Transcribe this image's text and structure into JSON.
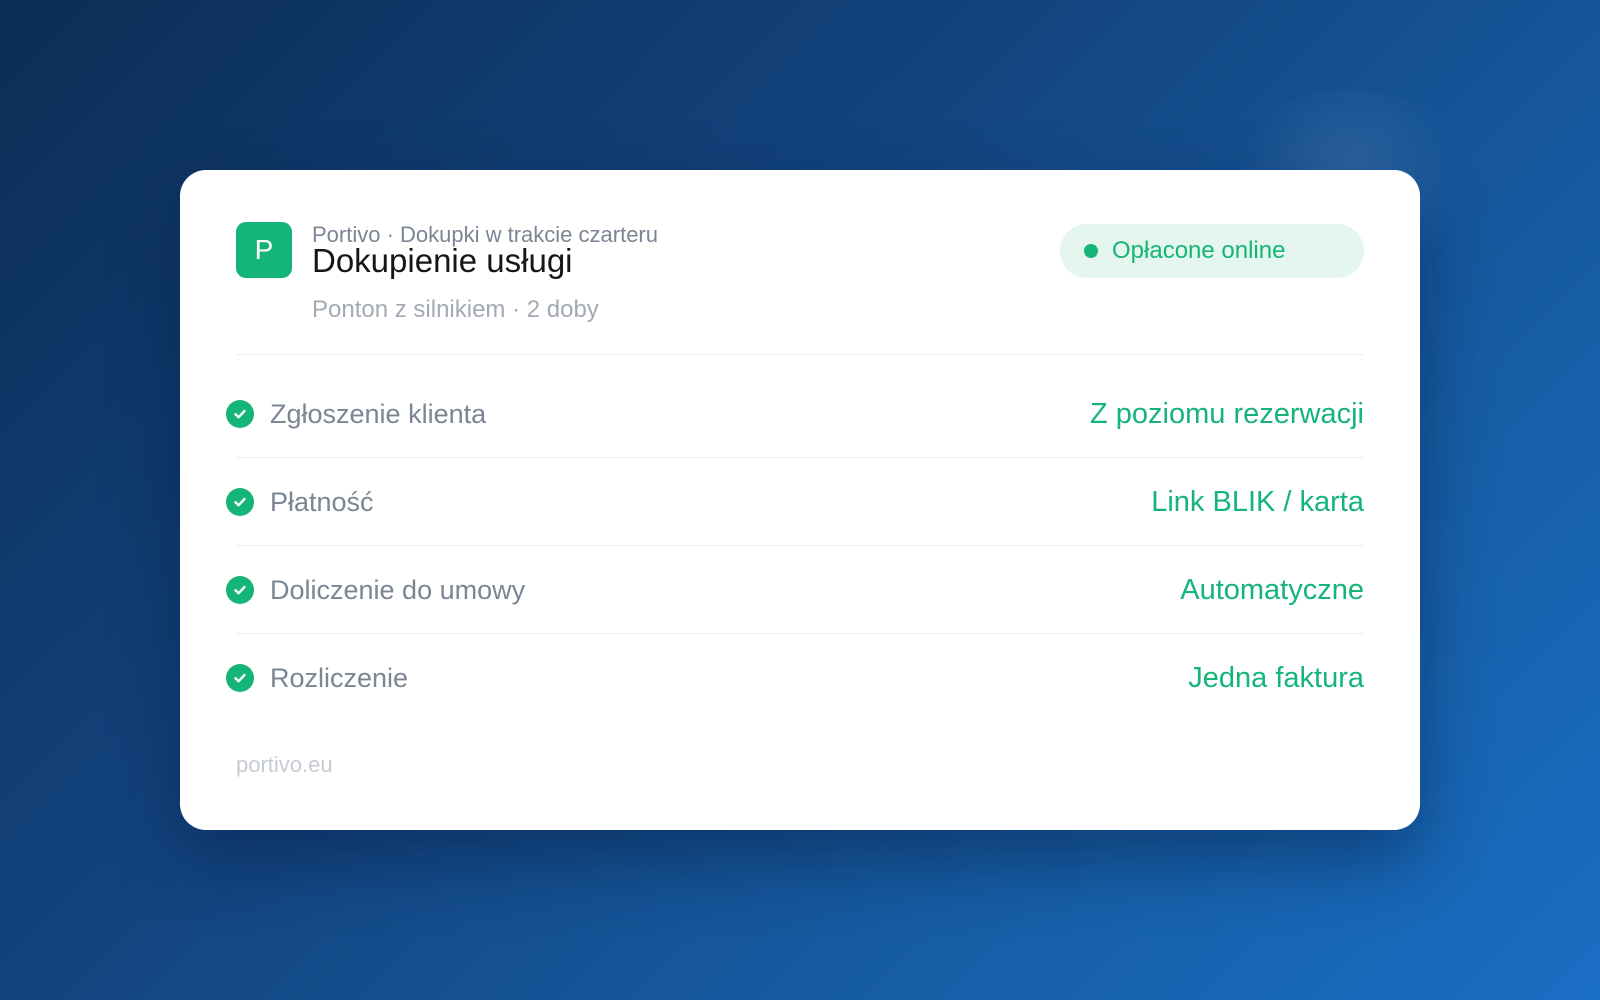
{
  "header": {
    "logo_letter": "P",
    "breadcrumb": "Portivo · Dokupki w trakcie czarteru",
    "title": "Dokupienie usługi",
    "subtitle": "Ponton z silnikiem · 2 doby"
  },
  "status_badge": {
    "label": "Opłacone online",
    "color": "#15b57a",
    "background": "#e4f6ee"
  },
  "steps": [
    {
      "label": "Zgłoszenie klienta",
      "value": "Z poziomu rezerwacji",
      "icon": "check-circle-icon",
      "done": true
    },
    {
      "label": "Płatność",
      "value": "Link BLIK / karta",
      "icon": "check-circle-icon",
      "done": true
    },
    {
      "label": "Doliczenie do umowy",
      "value": "Automatyczne",
      "icon": "check-circle-icon",
      "done": true
    },
    {
      "label": "Rozliczenie",
      "value": "Jedna faktura",
      "icon": "check-circle-icon",
      "done": true
    }
  ],
  "footer": {
    "domain": "portivo.eu"
  },
  "colors": {
    "accent": "#15b57a",
    "background_start": "#0c2d55",
    "background_end": "#1a6ec4"
  }
}
